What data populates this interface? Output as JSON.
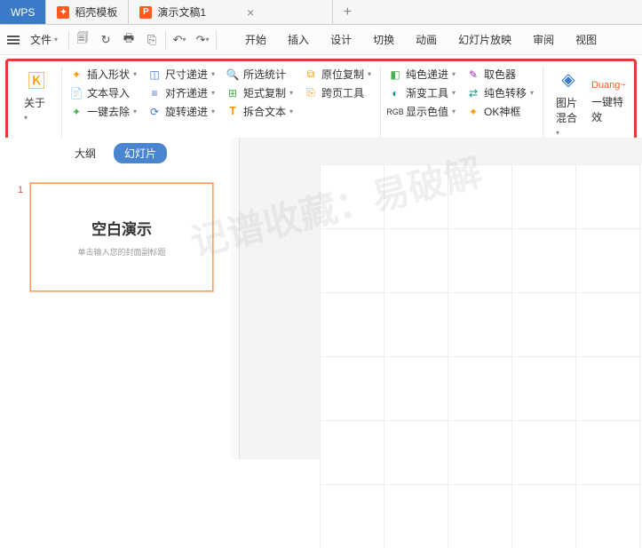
{
  "titlebar": {
    "wps": "WPS",
    "tab_dk": "稻壳模板",
    "tab_pres": "演示文稿1"
  },
  "menubar": {
    "file": "文件",
    "ribtabs": [
      "开始",
      "插入",
      "设计",
      "切换",
      "动画",
      "幻灯片放映",
      "审阅",
      "视图"
    ]
  },
  "ribbon": {
    "about": "关于",
    "g1": {
      "r1": [
        "插入形状",
        "尺寸递进",
        "所选统计",
        "原位复制"
      ],
      "r2": [
        "文本导入",
        "对齐递进",
        "矩式复制",
        "跨页工具"
      ],
      "r3": [
        "一键去除",
        "旋转递进",
        "拆合文本"
      ]
    },
    "g2": {
      "r1": [
        "纯色递进",
        "取色器"
      ],
      "r2": [
        "渐变工具",
        "纯色转移"
      ],
      "r3": [
        "显示色值",
        "OK神框"
      ]
    },
    "g3": {
      "blend": "图片混合",
      "fx_top": "Duang~",
      "fx": "一键特效"
    }
  },
  "side": {
    "tab_outline": "大纲",
    "tab_slide": "幻灯片",
    "num": "1",
    "title": "空白演示",
    "sub": "单击输入您的封面副标题"
  },
  "wm": "记谱收藏：易破解"
}
